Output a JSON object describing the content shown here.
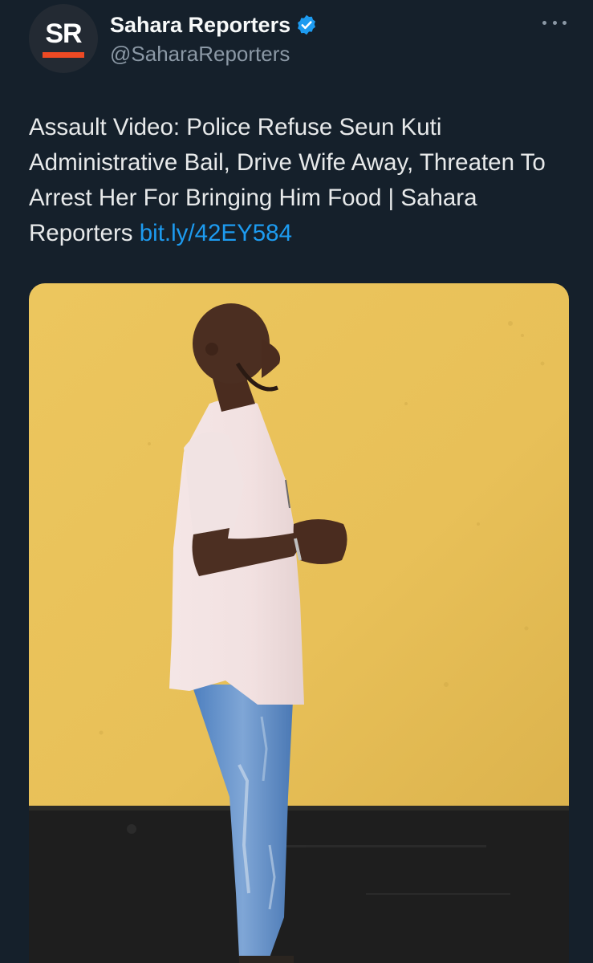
{
  "tweet": {
    "author": {
      "avatar_initials": "SR",
      "display_name": "Sahara Reporters",
      "handle": "@SaharaReporters",
      "verified": true
    },
    "more_icon": "more-horizontal-icon",
    "text": "Assault Video: Police Refuse Seun Kuti Administrative Bail, Drive Wife Away, Threaten To Arrest Her For Bringing Him Food | Sahara Reporters ",
    "link_text": "bit.ly/42EY584",
    "media": {
      "kind": "photo"
    }
  },
  "colors": {
    "background": "#15202b",
    "text": "#e7e9ea",
    "secondary_text": "#8b98a5",
    "link": "#1d9bf0",
    "verified_badge": "#1d9bf0",
    "brand_accent": "#ee4a24",
    "photo_wall": "#e9c25a",
    "photo_base": "#1c1c1c"
  }
}
